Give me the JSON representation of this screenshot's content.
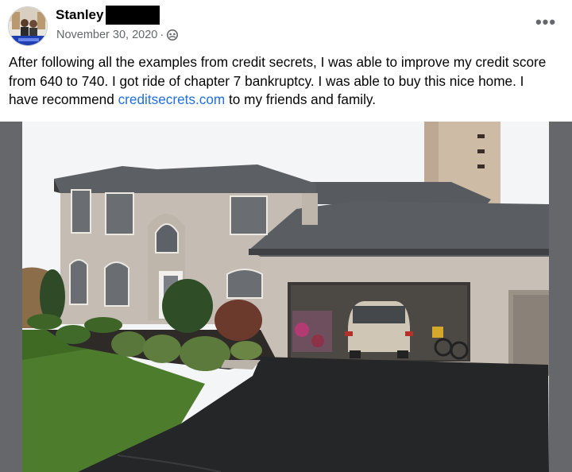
{
  "post": {
    "author_name": "Stanley",
    "date": "November 30, 2020",
    "separator": "·",
    "audience_icon": "friends-icon",
    "more_icon": "ellipsis-icon",
    "more_label": "•••",
    "text_part1": "After following all the examples from credit secrets,  I  was able to improve my credit score from 640 to 740. I got ride of  chapter 7 bankruptcy. I was able to buy this nice home. I have recommend ",
    "link_text": "creditsecrets.com",
    "text_part2": " to my friends and family."
  },
  "colors": {
    "text": "#050505",
    "meta": "#65676b",
    "link": "#216fdb",
    "photo_backdrop": "#65676b"
  }
}
